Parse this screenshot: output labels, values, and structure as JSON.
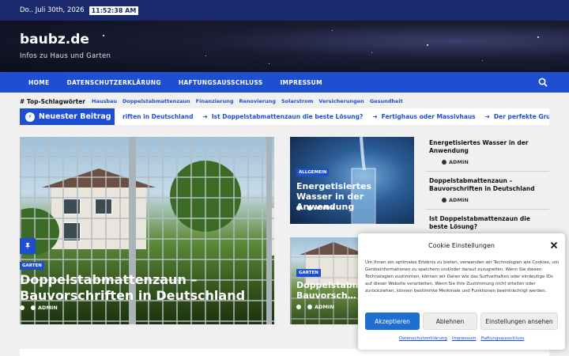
{
  "topbar": {
    "date": "Do.. Juli 30th, 2026",
    "time": "11:52:38 AM"
  },
  "site": {
    "name": "baubz.de",
    "tagline": "Infos zu Haus und Garten"
  },
  "nav": {
    "items": [
      "HOME",
      "DATENSCHUTZERKLÄRUNG",
      "HAFTUNGSAUSSCHLUSS",
      "IMPRESSUM"
    ]
  },
  "tags": {
    "heading": "# Top-Schlagwörter",
    "items": [
      "Hausbau",
      "Doppelstabmattenzaun",
      "Finanzierung",
      "Renovierung",
      "Solarstrom",
      "Versicherungen",
      "Gesundheit"
    ]
  },
  "ticker": {
    "label": "Neuester Beitrag",
    "items": [
      "riften in Deutschland",
      "Ist Doppelstabmattenzaun die beste Lösung?",
      "Fertighaus oder Massivhaus",
      "Der perfekte Grundriss"
    ]
  },
  "featured": {
    "category": "GARTEN",
    "title": "Doppelstabmattenzaun – Bauvorschriften in Deutschland",
    "author": "ADMIN"
  },
  "mid_cards": [
    {
      "category": "ALLGEMEIN",
      "title": "Energetisiertes Wasser in der Anwendung",
      "author": "ADMIN"
    },
    {
      "category": "GARTEN",
      "title": "Doppelstabm… – Bauvorsch…",
      "author": "ADMIN"
    }
  ],
  "list": [
    {
      "title": "Energetisiertes Wasser in der Anwendung",
      "author": "ADMIN"
    },
    {
      "title": "Doppelstabmattenzaun – Bauvorschriften in Deutschland",
      "author": "ADMIN"
    },
    {
      "title": "Ist Doppelstabmattenzaun die beste Lösung?",
      "author": ""
    }
  ],
  "cookie": {
    "title": "Cookie Einstellungen",
    "text": "Um Ihnen ein optimales Erlebnis zu bieten, verwenden wir Technologien wie Cookies, um Geräteinformationen zu speichern und/oder darauf zuzugreifen. Wenn Sie diesen Technologien zustimmen, können wir Daten wie das Surfverhalten oder eindeutige IDs auf dieser Website verarbeiten. Wenn Sie Ihre Zustimmung nicht erteilen oder zurückziehen, können bestimmte Merkmale und Funktionen beeinträchtigt werden.",
    "accept": "Akzeptieren",
    "deny": "Ablehnen",
    "prefs": "Einstellungen ansehen",
    "links": [
      "Datenschutzerklärung",
      "Impressum",
      "Haftungsausschluss"
    ]
  },
  "colors": {
    "accent": "#1e4fd1",
    "topbar": "#1a2a6c"
  }
}
